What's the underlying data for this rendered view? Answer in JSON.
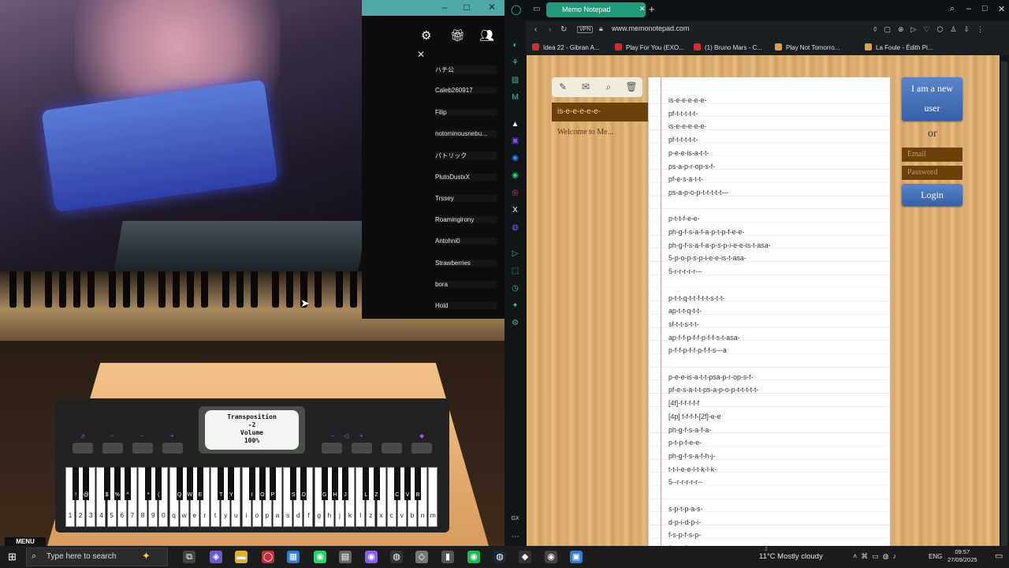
{
  "player_list": {
    "players": [
      "ハチ公",
      "Caleb260917",
      "Filip",
      "notominousnebu...",
      "パトリック",
      "PlutoDustxX",
      "Trssey",
      "Roamingirony",
      "Antohni0",
      "Strawberries",
      "bora",
      "Hold"
    ]
  },
  "piano_ui": {
    "screen_line1": "Transposition",
    "screen_line2": "-2",
    "screen_line3": "Volume",
    "screen_line4": "100%",
    "menu_label": "MENU",
    "white_keys": [
      "1",
      "2",
      "3",
      "4",
      "5",
      "6",
      "7",
      "8",
      "9",
      "0",
      "q",
      "w",
      "e",
      "r",
      "t",
      "y",
      "u",
      "i",
      "o",
      "p",
      "a",
      "s",
      "d",
      "f",
      "g",
      "h",
      "j",
      "k",
      "l",
      "z",
      "x",
      "c",
      "v",
      "b",
      "n",
      "m"
    ],
    "black_keys": [
      "!",
      "@",
      "$",
      "%",
      "^",
      "*",
      "(",
      "Q",
      "W",
      "E",
      "T",
      "Y",
      "I",
      "O",
      "P",
      "S",
      "D",
      "G",
      "H",
      "J",
      "L",
      "Z",
      "C",
      "V",
      "B"
    ]
  },
  "browser": {
    "tab_title": "Memo Notepad",
    "vpn_label": "VPN",
    "url": "www.memonotepad.com",
    "bookmarks": [
      "Idea 22 - Gibran A...",
      "Play For You (EXO...",
      "(1) Bruno Mars - C...",
      "Play Not Tomorro...",
      "La Foule - Édith Pi..."
    ]
  },
  "site": {
    "note_tab": "is-e-e-e-e-e-",
    "welcome": "Welcome to Me...",
    "new_user_line1": "I am a new",
    "new_user_line2": "user",
    "or_label": "or",
    "email_placeholder": "Email",
    "password_placeholder": "Password",
    "login_label": "Login",
    "note_lines": "is-e-e-e-e-e-\npf-t-t-t-t-t-\nis-e-e-e-e-e-\npf-t-t-t-t-t-\np-e-e-is-a-t-t-\nps-a-p-r-op-s-f-\npf-e-s-a-t-t-\nps-a-p-o-p-t-t-t-t-t---\n\np-t-t-f-e-e-\nph-g-f-s-a-f-a-p-t-p-f-e-e-\nph-g-f-s-a-f-a-p-s-p-i-e-e-is-t-asa-\n5-p-o-p-s-p-i-e-e-is-t-asa-\n5-r-r-r-r-r---\n\np-t-t-q-t-t-f-t-t-s-t-t-\nap-t-t-q-t-t-\nsf-t-t-s-t-t-\nap-f-f-p-f-f-p-f-f-s-t-asa-\np-f-f-p-f-f-p-f-f-s---a\n\np-e-e-is-a-t-t-psa-p-r-op-s-f-\npf-e-s-a-t-t-ps-a-p-o-p-t-t-t-t-t-\n[4f]-f-f-f-f-f\n[4p] f-f-f-f-[2f]-e-e\nph-g-f-s-a-f-a-\np-t-p-f-e-e-\nph-g-f-s-a-f-h-j-\nt-t-l-e-e-l-t-k-l-k-\n5--r-r-r-r-r--\n\ns-p-t-p-a-s-\nd-p-i-d-p-i-\nf-s-p-f-s-p-\nf-e-a-f-e-a"
  },
  "taskbar": {
    "search_placeholder": "Type here to search",
    "weather_temp": "11°C",
    "weather_text": "Mostly cloudy",
    "notif_count": "2",
    "language": "ENG",
    "time": "09:57",
    "date": "27/09/2025"
  },
  "colors": {
    "accent_teal": "#3ff0ea",
    "tab_green": "#1f9a7a",
    "note_brown": "#6b400b",
    "login_blue": "#355fa8"
  }
}
